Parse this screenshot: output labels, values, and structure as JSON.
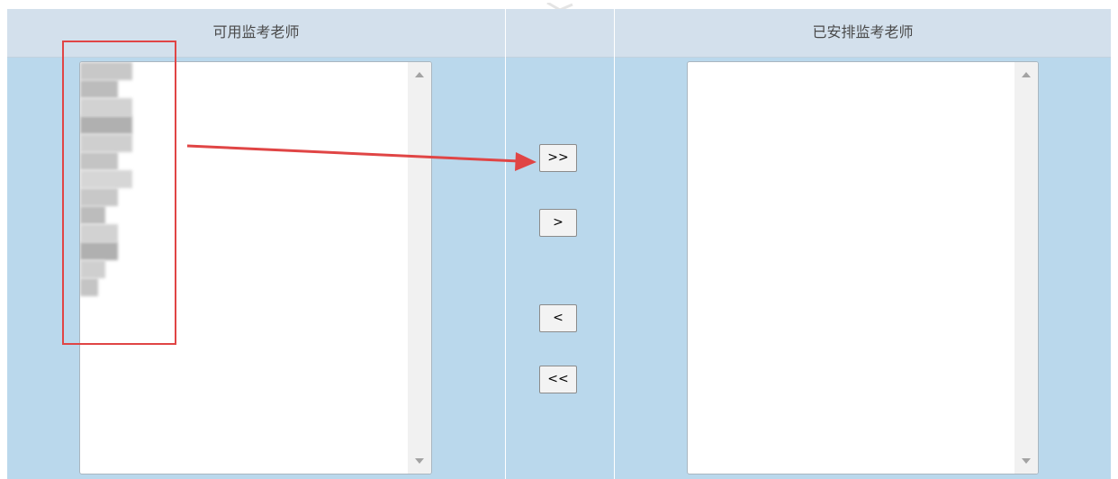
{
  "panels": {
    "available": {
      "title": "可用监考老师",
      "blurred_items": 13
    },
    "controls": {
      "title": ""
    },
    "assigned": {
      "title": "已安排监考老师"
    }
  },
  "buttons": {
    "add_all": ">>",
    "add_one": ">",
    "remove_one": "<",
    "remove_all": "<<"
  },
  "colors": {
    "header_bg": "#d3e0ec",
    "body_bg": "#bad8ec",
    "annotation": "#e04545"
  },
  "icons": {
    "scroll_up": "triangle-up",
    "scroll_down": "triangle-down",
    "annotation_arrow": "arrow-right"
  }
}
